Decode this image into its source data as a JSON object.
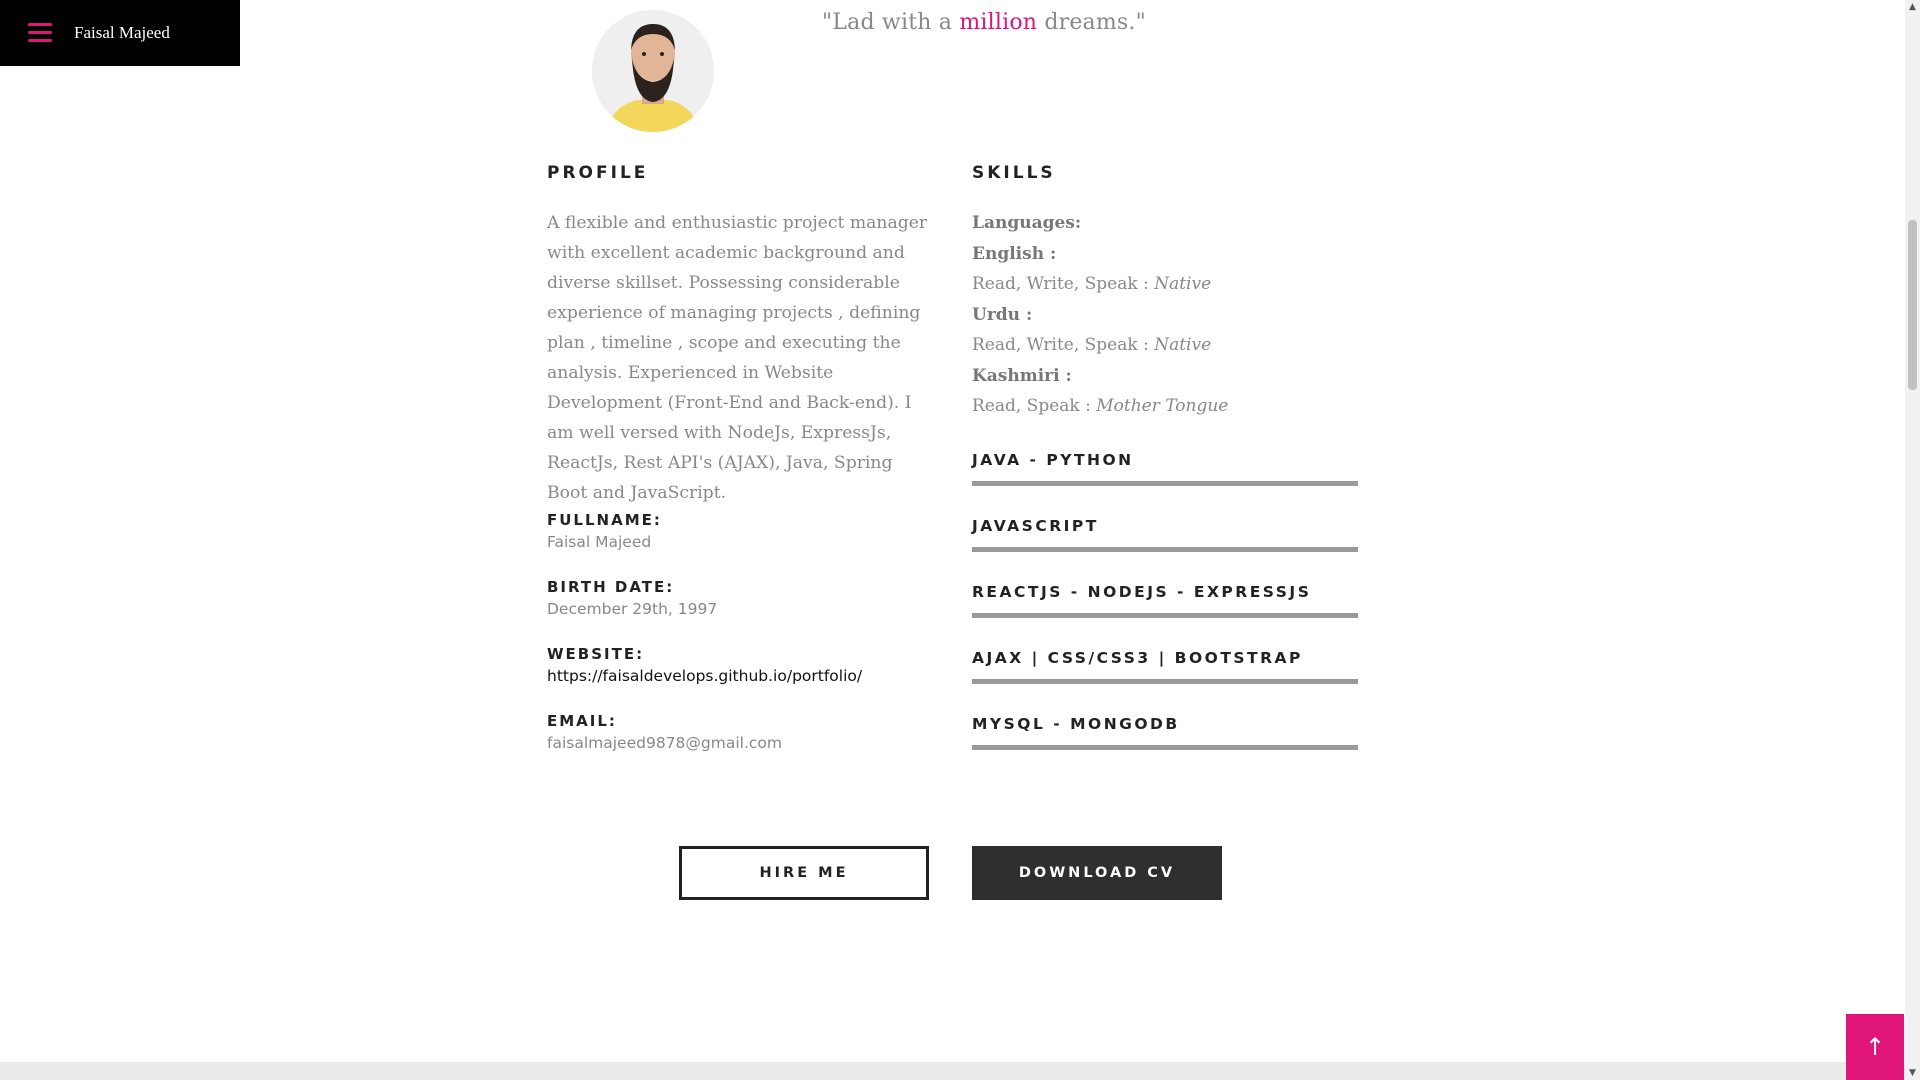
{
  "nav": {
    "brand": "Faisal Majeed"
  },
  "tagline": {
    "prefix": "\"Lad with a ",
    "highlight": "million",
    "suffix": " dreams.\""
  },
  "profile": {
    "heading": "PROFILE",
    "text": "A flexible and enthusiastic project manager with excellent academic background and diverse skillset. Possessing considerable experience of managing projects , defining plan , timeline , scope and executing the analysis. Experienced in Website Development (Front-End and Back-end). I am well versed with NodeJs, ExpressJs, ReactJs, Rest API's (AJAX), Java, Spring Boot and JavaScript.",
    "fields": [
      {
        "label": "FULLNAME:",
        "value": "Faisal Majeed"
      },
      {
        "label": "BIRTH DATE:",
        "value": "December 29th, 1997"
      },
      {
        "label": "WEBSITE:",
        "value": "https://faisaldevelops.github.io/portfolio/"
      },
      {
        "label": "EMAIL:",
        "value": "faisalmajeed9878@gmail.com"
      }
    ]
  },
  "skills": {
    "heading": "SKILLS",
    "languages_label": "Languages:",
    "languages": [
      {
        "name": "English :",
        "ability": "Read, Write, Speak : ",
        "level": "Native"
      },
      {
        "name": "Urdu :",
        "ability": "Read, Write, Speak : ",
        "level": "Native"
      },
      {
        "name": "Kashmiri :",
        "ability": "Read, Speak : ",
        "level": "Mother Tongue"
      }
    ],
    "bars": [
      {
        "label": "JAVA - PYTHON",
        "level": 1.0
      },
      {
        "label": "JAVASCRIPT",
        "level": 1.0
      },
      {
        "label": "REACTJS - NODEJS - EXPRESSJS",
        "level": 1.0
      },
      {
        "label": "AJAX | CSS/CSS3 | BOOTSTRAP",
        "level": 1.0
      },
      {
        "label": "MYSQL - MONGODB",
        "level": 1.0
      }
    ]
  },
  "buttons": {
    "hire": "HIRE ME",
    "cv": "DOWNLOAD CV"
  },
  "to_top": {
    "icon": "arrow-up-icon",
    "glyph": "↑"
  },
  "colors": {
    "accent": "#e0157a",
    "dark": "#2f2f2f"
  }
}
